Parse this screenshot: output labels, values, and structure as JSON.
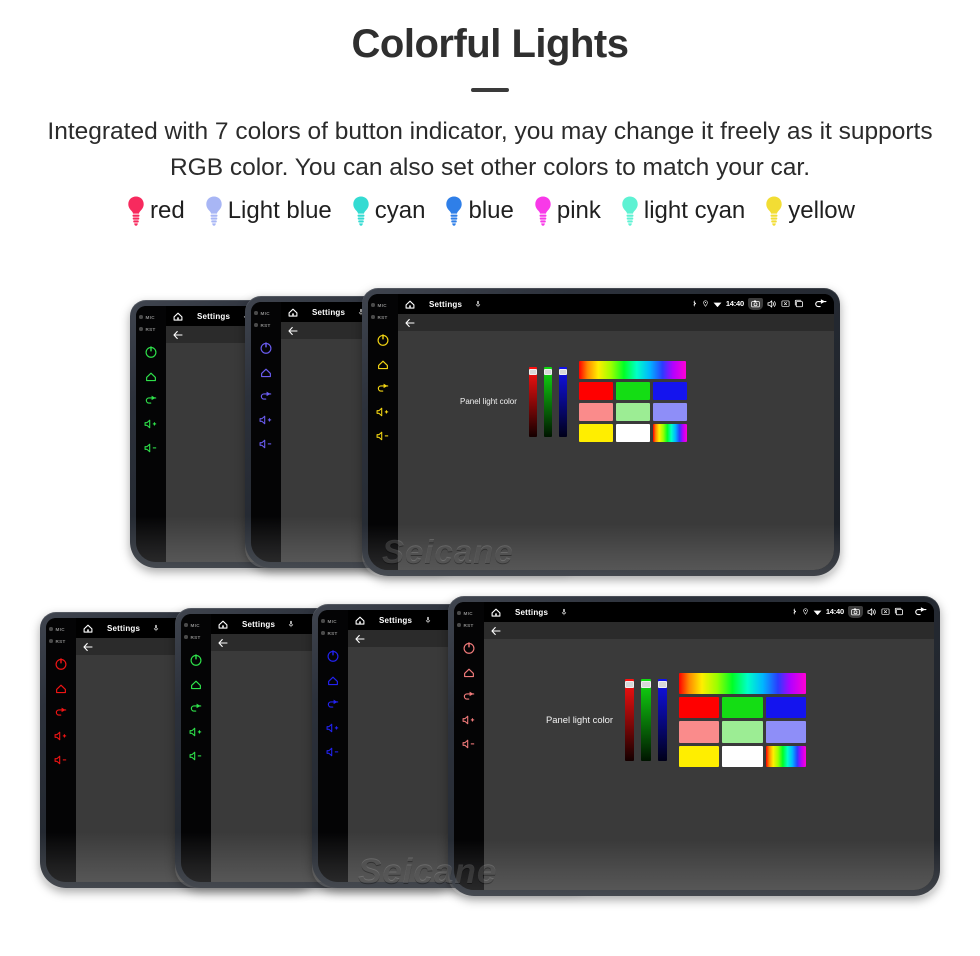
{
  "header": {
    "title": "Colorful Lights",
    "subtitle": "Integrated with 7 colors of button indicator, you may change it freely as it supports RGB color. You can also set other colors to match your car.",
    "divider": "horizontal-rule"
  },
  "legend": {
    "items": [
      {
        "label": "red",
        "color": "#f72a5e",
        "icon": "bulb-icon"
      },
      {
        "label": "Light blue",
        "color": "#a8b6f5",
        "icon": "bulb-icon"
      },
      {
        "label": "cyan",
        "color": "#34dbd2",
        "icon": "bulb-icon"
      },
      {
        "label": "blue",
        "color": "#2f7fe8",
        "icon": "bulb-icon"
      },
      {
        "label": "pink",
        "color": "#f839e8",
        "icon": "bulb-icon"
      },
      {
        "label": "light cyan",
        "color": "#5ef2d3",
        "icon": "bulb-icon"
      },
      {
        "label": "yellow",
        "color": "#f2dd34",
        "icon": "bulb-icon"
      }
    ]
  },
  "device_ui": {
    "indicator_mic": "MIC",
    "indicator_rst": "RST",
    "side_buttons": [
      {
        "name": "power-button",
        "icon": "power-icon"
      },
      {
        "name": "home-button",
        "icon": "home-outline-icon"
      },
      {
        "name": "back-button",
        "icon": "back-arrow-icon"
      },
      {
        "name": "volume-up-button",
        "icon": "volume-up-icon"
      },
      {
        "name": "volume-down-button",
        "icon": "volume-down-icon"
      }
    ],
    "status_bar": {
      "home_icon": "home-icon",
      "title": "Settings",
      "mic_icon": "microphone-icon",
      "bluetooth_icon": "bluetooth-icon",
      "location_icon": "location-pin-icon",
      "wifi_icon": "wifi-icon",
      "time": "14:40",
      "screenshot_icon": "camera-icon",
      "volume_icon": "speaker-icon",
      "close_icon": "x-box-icon",
      "recents_icon": "recents-icon",
      "back_icon": "back-arrow-icon"
    },
    "action_bar": {
      "back_icon": "back-arrow-icon"
    },
    "panel": {
      "label": "Panel light color",
      "sliders": [
        {
          "name": "red-slider",
          "top_color": "#ff1111",
          "bottom_color": "#140000",
          "value": 100
        },
        {
          "name": "green-slider",
          "top_color": "#11dd11",
          "bottom_color": "#001400",
          "value": 100
        },
        {
          "name": "blue-slider",
          "top_color": "#1111ee",
          "bottom_color": "#000018",
          "value": 100
        }
      ],
      "rainbow_bar": "hue-spectrum-bar",
      "swatches": [
        [
          {
            "name": "swatch-red",
            "color": "#ff0000"
          },
          {
            "name": "swatch-green",
            "color": "#14dd14"
          },
          {
            "name": "swatch-blue",
            "color": "#1414ee"
          }
        ],
        [
          {
            "name": "swatch-salmon",
            "color": "#fa8b8b"
          },
          {
            "name": "swatch-lightgreen",
            "color": "#9ced94"
          },
          {
            "name": "swatch-periwinkle",
            "color": "#8e8ef8"
          }
        ],
        [
          {
            "name": "swatch-yellow",
            "color": "#ffee00"
          },
          {
            "name": "swatch-white",
            "color": "#ffffff"
          },
          {
            "name": "swatch-rainbow",
            "color": "rainbow"
          }
        ]
      ]
    }
  },
  "units_top": [
    {
      "name": "head-unit-green",
      "led_color": "#2ee04a"
    },
    {
      "name": "head-unit-violet",
      "led_color": "#6a5cf0"
    },
    {
      "name": "head-unit-yellow",
      "led_color": "#f2d413"
    }
  ],
  "units_bottom": [
    {
      "name": "head-unit-red",
      "led_color": "#f01414"
    },
    {
      "name": "head-unit-green",
      "led_color": "#2ee04a"
    },
    {
      "name": "head-unit-blue",
      "led_color": "#2222f0"
    },
    {
      "name": "head-unit-salmon",
      "led_color": "#f07a7a"
    }
  ],
  "watermark": {
    "text": "Seicane"
  }
}
